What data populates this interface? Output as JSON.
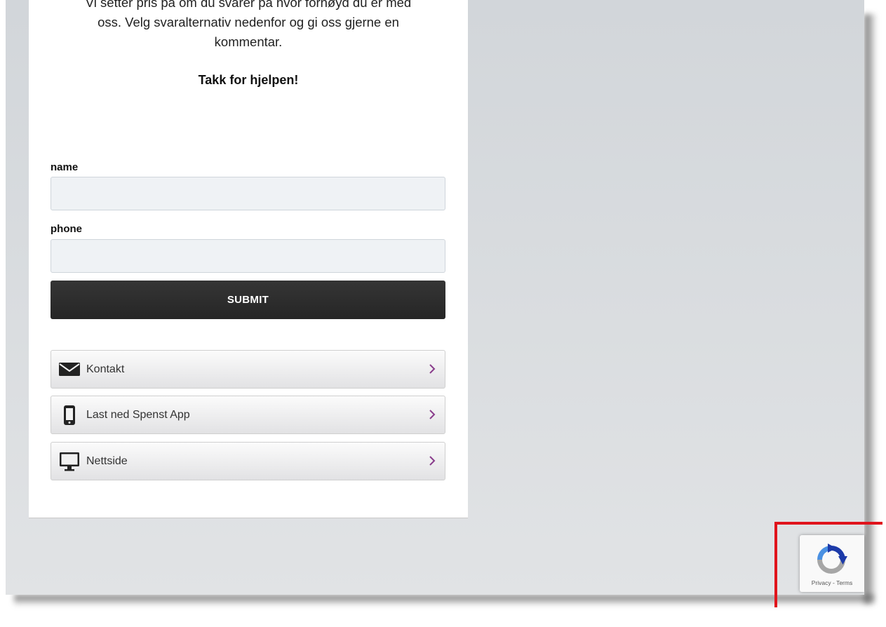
{
  "intro": {
    "line1": "Vi setter pris på om du svarer på hvor fornøyd du er med",
    "line2": "oss. Velg svaralternativ nedenfor og gi oss gjerne en",
    "line3": "kommentar.",
    "thanks": "Takk for hjelpen!"
  },
  "form": {
    "name_label": "name",
    "name_value": "",
    "phone_label": "phone",
    "phone_value": "",
    "submit_label": "SUBMIT"
  },
  "links": [
    {
      "label": "Kontakt",
      "icon": "envelope-icon"
    },
    {
      "label": "Last ned Spenst App",
      "icon": "mobile-phone-icon"
    },
    {
      "label": "Nettside",
      "icon": "monitor-icon"
    }
  ],
  "recaptcha": {
    "privacy": "Privacy",
    "separator": " - ",
    "terms": "Terms"
  },
  "colors": {
    "chevron": "#8a3d8c",
    "submit_bg": "#2c2c2c",
    "annotation": "#e0141c",
    "recaptcha_blue": "#1c3aa9",
    "recaptcha_light_blue": "#4a90e2"
  }
}
